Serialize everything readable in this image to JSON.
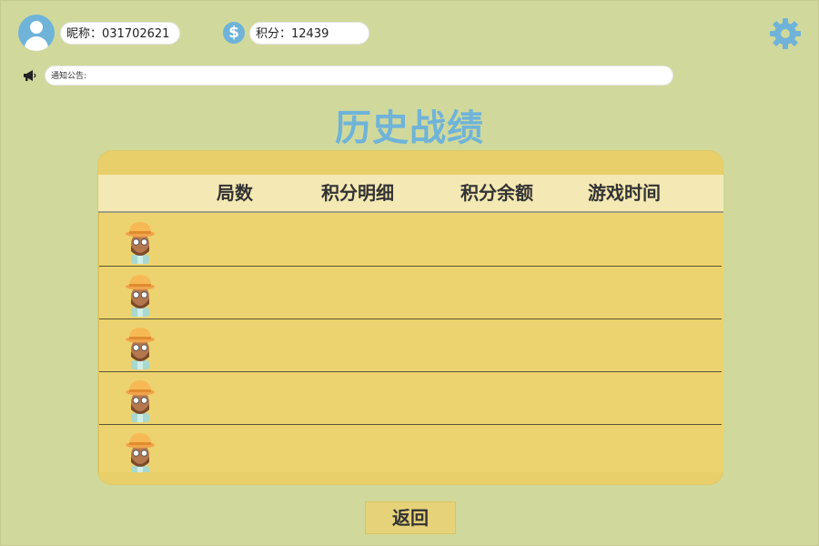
{
  "user": {
    "nickname_text": "昵称：031702621",
    "score_text": "积分：12439"
  },
  "icons": {
    "avatar": "user-avatar-icon",
    "coin": "dollar-coin-icon",
    "settings": "gear-icon",
    "notice": "megaphone-icon"
  },
  "coin_glyph": "$",
  "notice": {
    "label": "通知公告:"
  },
  "page_title": "历史战绩",
  "table": {
    "headers": [
      "局数",
      "积分明细",
      "积分余额",
      "游戏时间"
    ],
    "rows": [
      {
        "round": "",
        "detail": "",
        "balance": "",
        "time": ""
      },
      {
        "round": "",
        "detail": "",
        "balance": "",
        "time": ""
      },
      {
        "round": "",
        "detail": "",
        "balance": "",
        "time": ""
      },
      {
        "round": "",
        "detail": "",
        "balance": "",
        "time": ""
      },
      {
        "round": "",
        "detail": "",
        "balance": "",
        "time": ""
      }
    ]
  },
  "back_button": "返回",
  "colors": {
    "background": "#d0d99b",
    "accent": "#6fb3d9",
    "panel": "#e8cf6a",
    "header": "#f4e9b4"
  }
}
